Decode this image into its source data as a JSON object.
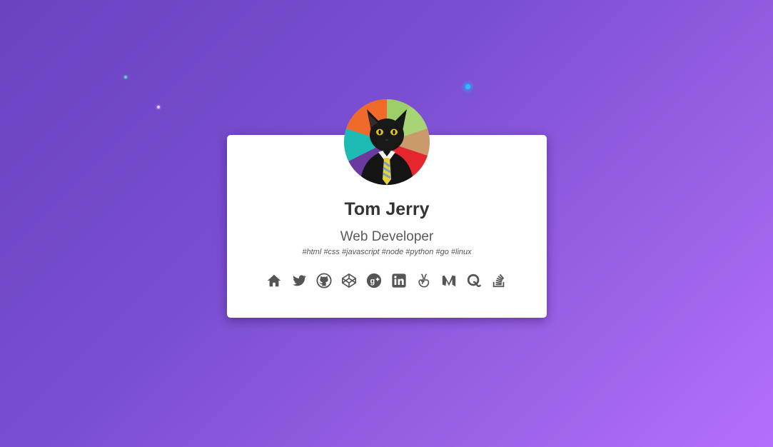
{
  "profile": {
    "name": "Tom Jerry",
    "role": "Web Developer",
    "tags": "#html #css #javascript #node #python #go #linux"
  },
  "social": [
    {
      "icon": "home-icon"
    },
    {
      "icon": "twitter-icon"
    },
    {
      "icon": "github-icon"
    },
    {
      "icon": "codepen-icon"
    },
    {
      "icon": "google-plus-icon"
    },
    {
      "icon": "linkedin-icon"
    },
    {
      "icon": "angellist-icon"
    },
    {
      "icon": "medium-icon"
    },
    {
      "icon": "quora-icon"
    },
    {
      "icon": "stack-overflow-icon"
    }
  ],
  "colors": {
    "background_start": "#6a42c2",
    "background_end": "#b46ffc",
    "card": "#ffffff",
    "name_text": "#333333",
    "icon": "#555555"
  }
}
